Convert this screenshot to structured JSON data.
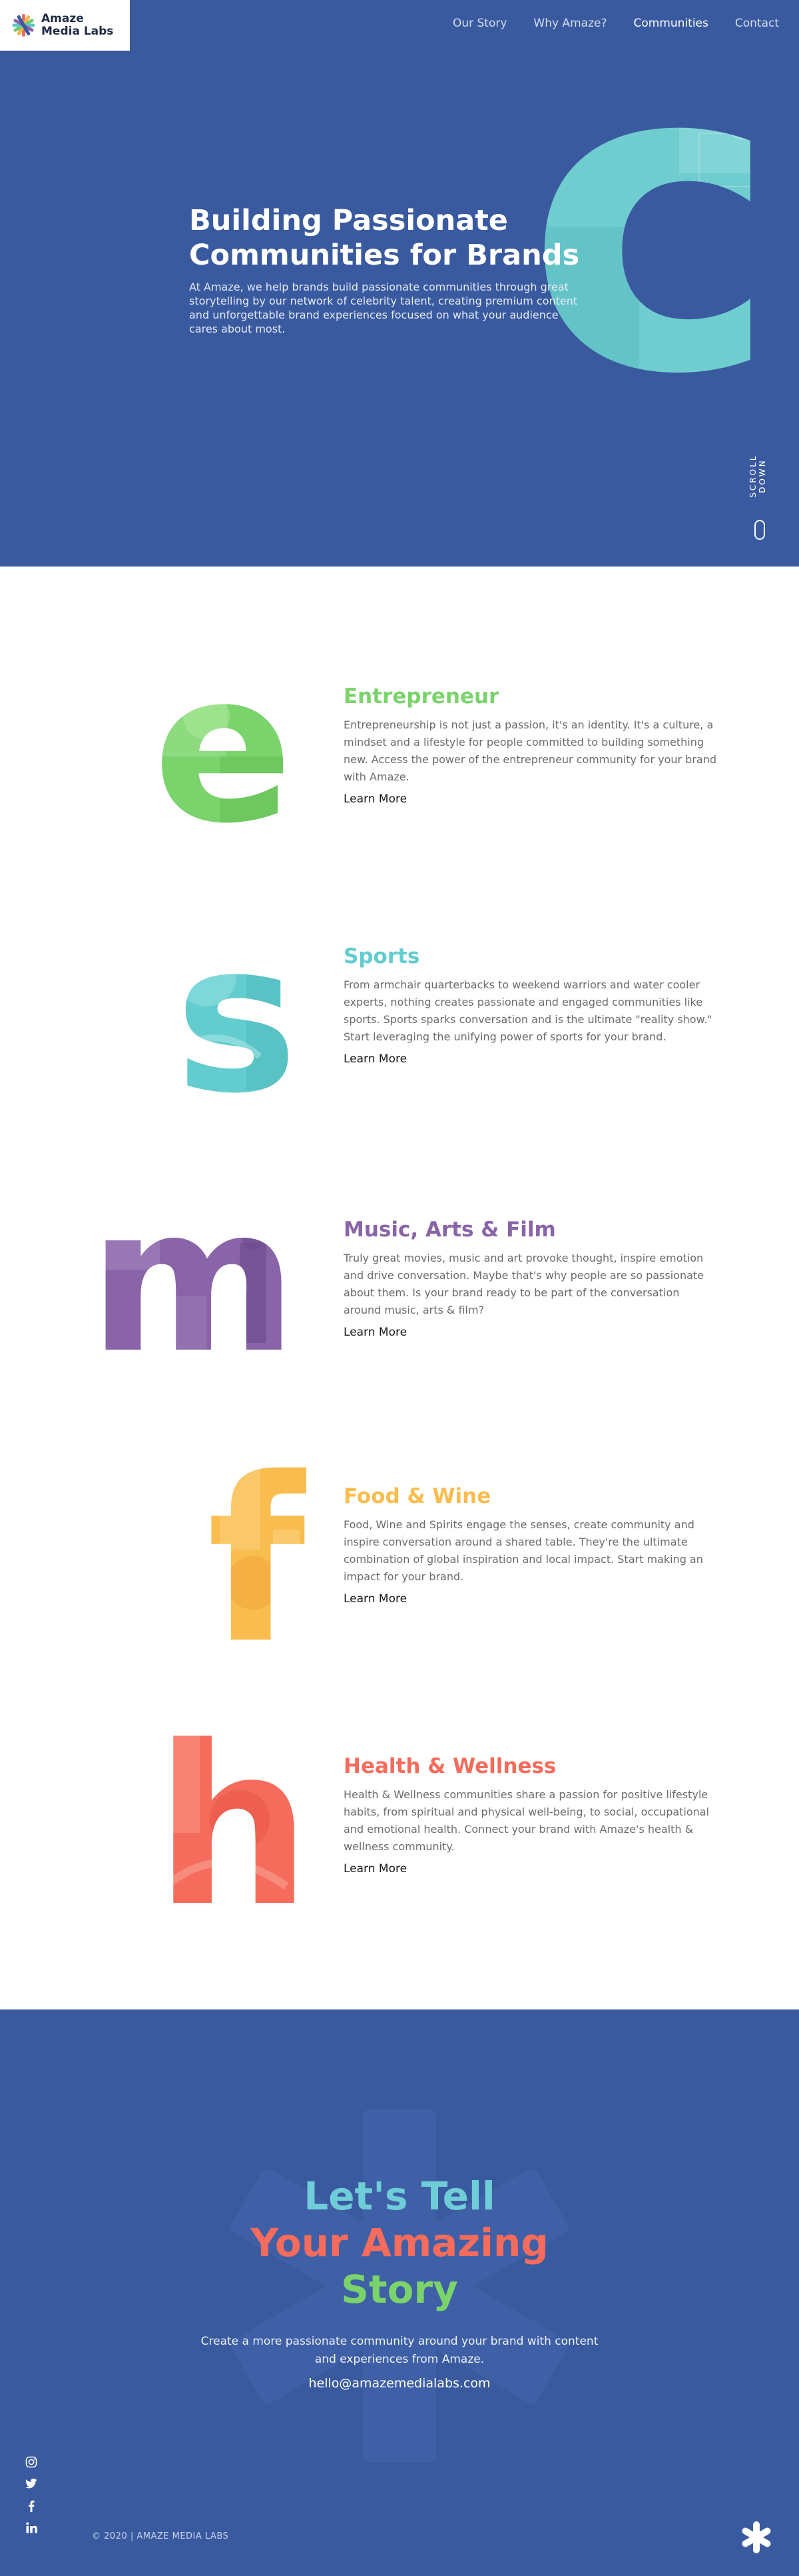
{
  "brand": {
    "name_line1": "Amaze",
    "name_line2": "Media Labs",
    "logo_colors": [
      "#f26c5a",
      "#f6b64b",
      "#76c96a",
      "#5fc8c8",
      "#8a64a8",
      "#3a5aa0"
    ]
  },
  "nav": {
    "items": [
      {
        "label": "Our Story"
      },
      {
        "label": "Why Amaze?"
      },
      {
        "label": "Communities",
        "active": true
      },
      {
        "label": "Contact"
      }
    ]
  },
  "hero": {
    "title": "Building Passionate Communities for Brands",
    "text": "At Amaze, we help brands build passionate communities through great storytelling by our network of celebrity talent, creating premium content and unforgettable brand experiences focused on what your audience cares about most.",
    "letter": "c",
    "letter_color": "#6fcdd0",
    "background": "#3a5aa0",
    "scroll_label": "SCROLL DOWN"
  },
  "communities": [
    {
      "letter": "e",
      "title": "Entrepreneur",
      "color": "#7bd36b",
      "description": "Entrepreneurship is not just a passion, it's an identity. It's a culture, a mindset and a lifestyle for people committed to building something new. Access the power of the entrepreneur community for your brand with Amaze.",
      "link": "Learn More"
    },
    {
      "letter": "s",
      "title": "Sports",
      "color": "#62cccf",
      "description": "From armchair quarterbacks to weekend warriors and water cooler experts, nothing creates passionate and engaged communities like sports. Sports sparks conversation and is the ultimate \"reality show.\" Start leveraging the unifying power of sports for your brand.",
      "link": "Learn More"
    },
    {
      "letter": "m",
      "title": "Music, Arts & Film",
      "color": "#8a64a8",
      "description": "Truly great movies, music and art provoke thought, inspire emotion and drive conversation. Maybe that's why people are so passionate about them. Is your brand ready to be part of the conversation around music, arts & film?",
      "link": "Learn More"
    },
    {
      "letter": "f",
      "title": "Food & Wine",
      "color": "#f9bc4f",
      "description": "Food, Wine and Spirits engage the senses, create community and inspire conversation around a shared table. They're the ultimate combination of global inspiration and local impact. Start making an impact for your brand.",
      "link": "Learn More"
    },
    {
      "letter": "h",
      "title": "Health & Wellness",
      "color": "#f56b5c",
      "description": "Health & Wellness communities share a passion for positive lifestyle habits, from spiritual and physical well-being, to social, occupational and emotional health. Connect your brand with Amaze's health & wellness community.",
      "link": "Learn More"
    }
  ],
  "cta": {
    "line1": "Let's Tell",
    "line2": "Your Amazing",
    "line3": "Story",
    "line1_color": "#6fcdd8",
    "line2_color": "#f56b5c",
    "line3_color": "#7bd36b",
    "text": "Create a more passionate community around your brand with content and experiences from Amaze.",
    "email": "hello@amazemedialabs.com"
  },
  "social": [
    {
      "icon": "instagram-icon",
      "glyph": "◎"
    },
    {
      "icon": "twitter-icon",
      "glyph": "🐦"
    },
    {
      "icon": "facebook-icon",
      "glyph": "f"
    },
    {
      "icon": "linkedin-icon",
      "glyph": "in"
    }
  ],
  "footer": {
    "copyright": "© 2020 | AMAZE MEDIA LABS"
  }
}
